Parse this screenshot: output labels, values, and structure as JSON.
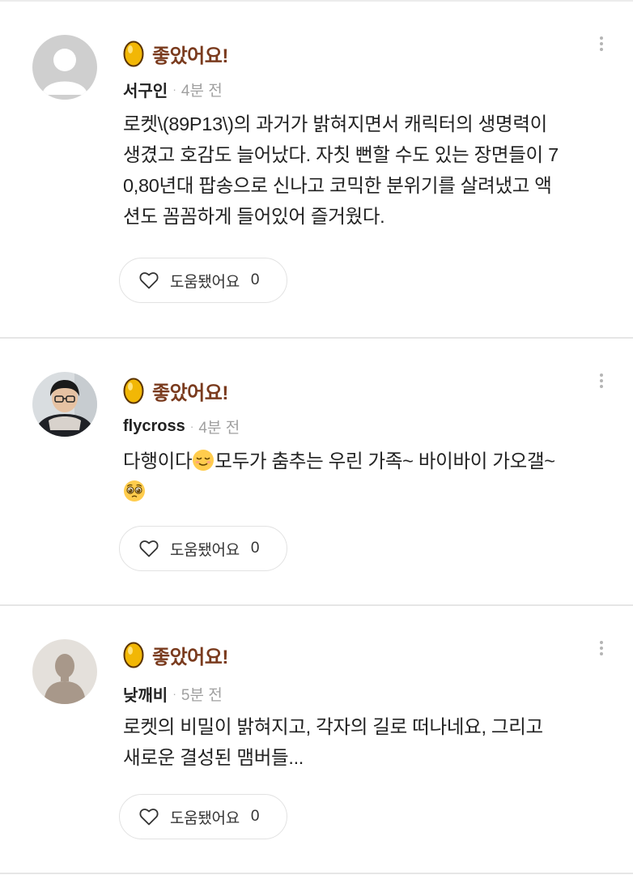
{
  "reviews": [
    {
      "avatar_icon": "default-avatar-icon",
      "rating_icon": "golden-egg-icon",
      "rating_label": "좋았어요!",
      "username": "서구인",
      "separator": "·",
      "timestamp": "4분 전",
      "text_lines": [
        "로켓\\(89P13\\)의 과거가 밝혀지면서 캐릭터의 생명력이",
        "생겼고 호감도 늘어났다. 자칫 뻔할 수도 있는 장면들이 7",
        "0,80년대 팝송으로 신나고 코믹한 분위기를 살려냈고 액",
        "션도 꼼꼼하게 들어있어 즐거웠다."
      ],
      "helpful_label": "도움됐어요",
      "helpful_count": "0"
    },
    {
      "avatar_icon": "user-photo-avatar",
      "rating_icon": "golden-egg-icon",
      "rating_label": "좋았어요!",
      "username": "flycross",
      "separator": "·",
      "timestamp": "4분 전",
      "text_line1_a": "다행이다",
      "text_line1_b": "모두가 춤추는 우린 가족~ 바이바이 가오갤~",
      "emoji_1": "relieved-face-emoji",
      "emoji_2": "pleading-face-emoji",
      "helpful_label": "도움됐어요",
      "helpful_count": "0"
    },
    {
      "avatar_icon": "silhouette-avatar-icon",
      "rating_icon": "golden-egg-icon",
      "rating_label": "좋았어요!",
      "username": "낮깨비",
      "separator": "·",
      "timestamp": "5분 전",
      "text_lines": [
        "로켓의 비밀이 밝혀지고, 각자의 길로 떠나네요, 그리고",
        "새로운 결성된 맴버들..."
      ],
      "helpful_label": "도움됐어요",
      "helpful_count": "0"
    }
  ],
  "colors": {
    "rating_label": "#7a3b1e",
    "egg": "#f2b705",
    "divider": "#e6e6e6",
    "timestamp": "#a0a0a0"
  }
}
